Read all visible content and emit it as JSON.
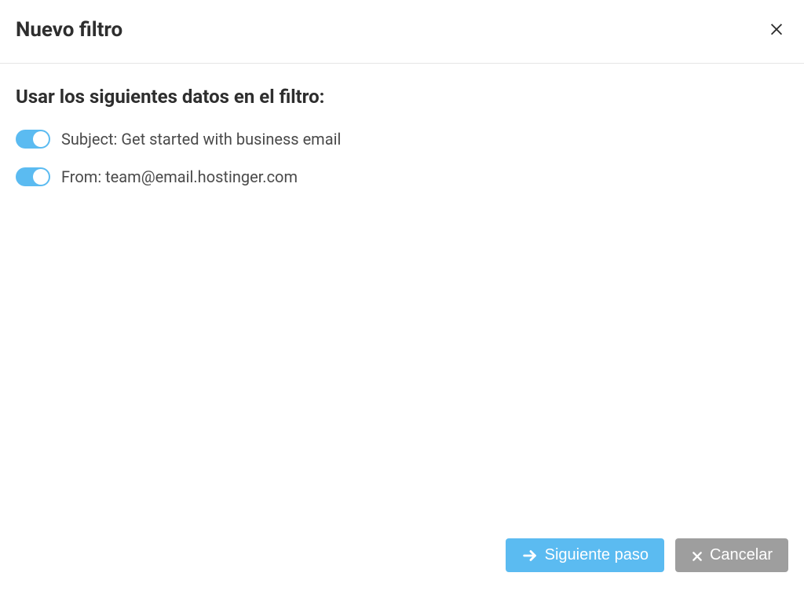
{
  "header": {
    "title": "Nuevo filtro"
  },
  "content": {
    "subtitle": "Usar los siguientes datos en el filtro:",
    "filters": [
      {
        "label": "Subject: Get started with business email",
        "on": true
      },
      {
        "label": "From: team@email.hostinger.com",
        "on": true
      }
    ]
  },
  "footer": {
    "next_label": "Siguiente paso",
    "cancel_label": "Cancelar"
  },
  "colors": {
    "accent": "#5bbbf1",
    "secondary": "#9e9e9e"
  }
}
